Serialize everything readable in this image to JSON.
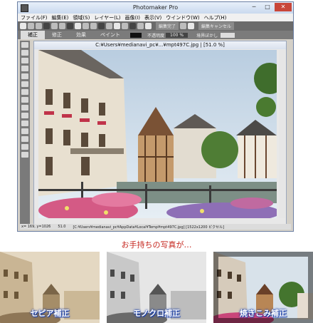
{
  "app": {
    "title": "Photomaker Pro"
  },
  "window_controls": {
    "minimize": "─",
    "maximize": "□",
    "close": "✕"
  },
  "menu": [
    "ファイル(F)",
    "編集(E)",
    "領域(S)",
    "レイヤー(L)",
    "画像(I)",
    "表示(V)",
    "ウインドウ(W)",
    "ヘルプ(H)"
  ],
  "toolbar": {
    "apply_label": "編集完了",
    "cancel_label": "編集キャンセル"
  },
  "tabs": [
    "補正",
    "修正",
    "効果",
    "ペイント"
  ],
  "tab_bar": {
    "opacity_label": "不透明度",
    "opacity_value": "100 %",
    "edge_label": "境界ぼかし"
  },
  "document": {
    "title": "C:¥Users¥medianavi_pc¥...¥mpt497C.jpg | [51.0 %]",
    "status_coords": "x= 169, y=1026",
    "status_zoom": "51.0",
    "status_path": "[C:¥Users¥medianavi_pc¥AppData¥Local¥Temp¥mpt497C.jpg] [1522x1200 ピクセル]"
  },
  "caption": "お手持ちの写真が…",
  "thumbnails": [
    {
      "label": "セピア補正"
    },
    {
      "label": "モノクロ補正"
    },
    {
      "label": "焼きこみ補正"
    }
  ]
}
